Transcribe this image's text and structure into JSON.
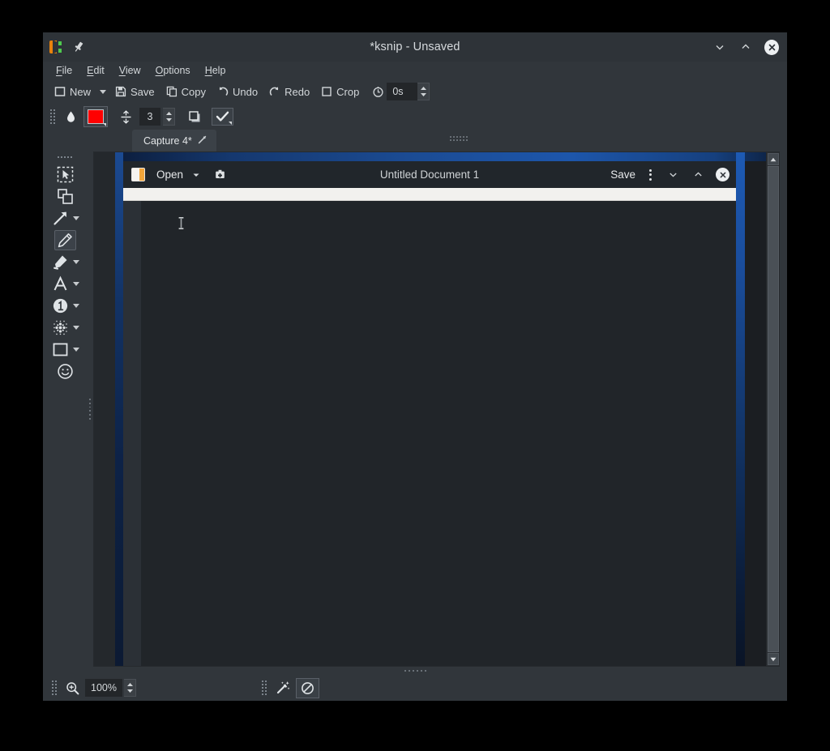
{
  "window": {
    "title": "*ksnip - Unsaved",
    "logo_icon": "ksnip-logo-icon",
    "pin_icon": "pin-icon",
    "controls": {
      "minimize": "minimize-icon",
      "maximize": "maximize-icon",
      "close": "close-icon"
    }
  },
  "menubar": {
    "items": [
      {
        "label": "File",
        "mnemonic": "F",
        "rest": "ile"
      },
      {
        "label": "Edit",
        "mnemonic": "E",
        "rest": "dit"
      },
      {
        "label": "View",
        "mnemonic": "V",
        "rest": "iew"
      },
      {
        "label": "Options",
        "mnemonic": "O",
        "rest": "ptions"
      },
      {
        "label": "Help",
        "mnemonic": "H",
        "rest": "elp"
      }
    ]
  },
  "toolbar": {
    "new_label": "New",
    "save_label": "Save",
    "copy_label": "Copy",
    "undo_label": "Undo",
    "redo_label": "Redo",
    "crop_label": "Crop",
    "delay_value": "0s",
    "delay_icon": "clock-icon"
  },
  "annotation_toolbar": {
    "fill_icon": "droplet-fill-icon",
    "color_value": "#ff0000",
    "width_icon": "line-width-icon",
    "width_value": "3",
    "shadow_icon": "drop-shadow-icon",
    "check_icon": "checkmark-icon"
  },
  "tabs": [
    {
      "label": "Capture 4*",
      "close_icon": "close-tab-icon",
      "active": true
    }
  ],
  "tools": [
    {
      "name": "select-tool",
      "icon": "selection-cursor-icon",
      "has_caret": false,
      "active": false
    },
    {
      "name": "duplicate-tool",
      "icon": "copy-shapes-icon",
      "has_caret": false,
      "active": false
    },
    {
      "name": "arrow-tool",
      "icon": "arrow-icon",
      "has_caret": true,
      "active": false
    },
    {
      "name": "pen-tool",
      "icon": "pencil-icon",
      "has_caret": false,
      "active": true
    },
    {
      "name": "marker-tool",
      "icon": "marker-highlighter-icon",
      "has_caret": true,
      "active": false
    },
    {
      "name": "text-tool",
      "icon": "text-a-icon",
      "has_caret": true,
      "active": false
    },
    {
      "name": "number-tool",
      "icon": "number-one-circle-icon",
      "has_caret": true,
      "active": false
    },
    {
      "name": "blur-tool",
      "icon": "blur-dots-icon",
      "has_caret": true,
      "active": false
    },
    {
      "name": "rectangle-tool",
      "icon": "rectangle-icon",
      "has_caret": true,
      "active": false
    },
    {
      "name": "sticker-tool",
      "icon": "smiley-face-icon",
      "has_caret": false,
      "active": false
    }
  ],
  "canvas": {
    "captured": {
      "app_icon": "gedit-document-icon",
      "open_label": "Open",
      "open_caret_icon": "chevron-down-icon",
      "new_doc_icon": "new-document-icon",
      "document_title": "Untitled Document 1",
      "save_label": "Save",
      "menu_icon": "kebab-menu-icon",
      "minimize_icon": "minimize-icon",
      "maximize_icon": "maximize-icon",
      "close_icon": "close-icon",
      "mouse_cursor": "text-ibeam-cursor"
    },
    "scrollbar": {
      "up_icon": "scroll-up-arrow-icon",
      "down_icon": "scroll-down-arrow-icon"
    }
  },
  "statusbar": {
    "zoom_icon": "magnifier-zoom-icon",
    "zoom_value": "100%",
    "wand_icon": "magic-wand-icon",
    "disabled_icon": "no-entry-circle-icon"
  }
}
